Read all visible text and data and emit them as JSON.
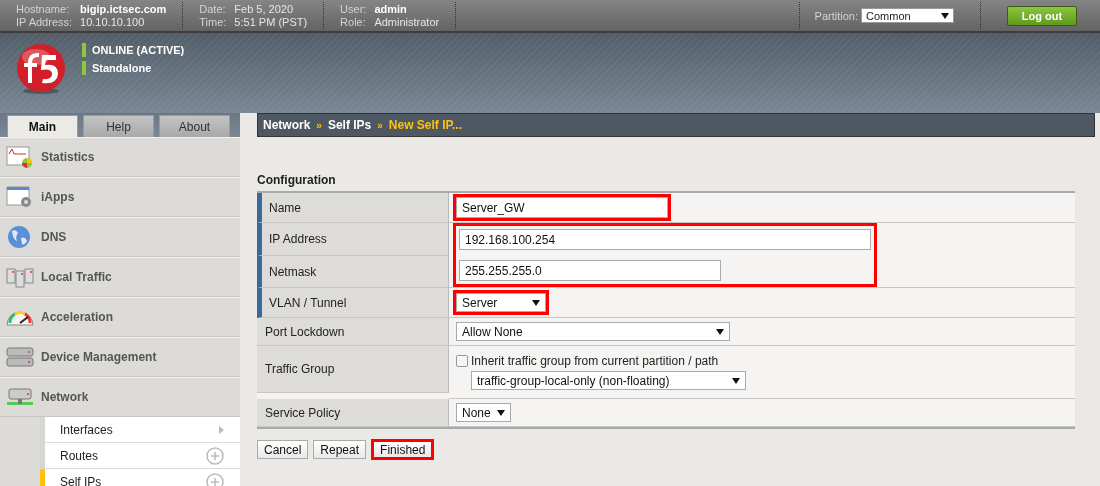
{
  "header": {
    "info": [
      [
        {
          "label": "Hostname:",
          "value": "bigip.ictsec.com",
          "strong": true
        },
        {
          "label": "IP Address:",
          "value": "10.10.10.100",
          "strong": false
        }
      ],
      [
        {
          "label": "Date:",
          "value": "Feb 5, 2020",
          "strong": false
        },
        {
          "label": "Time:",
          "value": "5:51 PM (PST)",
          "strong": false
        }
      ],
      [
        {
          "label": "User:",
          "value": "admin",
          "strong": true
        },
        {
          "label": "Role:",
          "value": "Administrator",
          "strong": false
        }
      ]
    ],
    "partition": {
      "label": "Partition:",
      "value": "Common"
    },
    "logout": "Log out"
  },
  "status": [
    {
      "text": "ONLINE (ACTIVE)",
      "color": "#8dc63f"
    },
    {
      "text": "Standalone",
      "color": "#8dc63f"
    }
  ],
  "tabs": [
    {
      "label": "Main",
      "selected": true
    },
    {
      "label": "Help",
      "selected": false
    },
    {
      "label": "About",
      "selected": false
    }
  ],
  "sidebar": {
    "items": [
      {
        "label": "Statistics"
      },
      {
        "label": "iApps"
      },
      {
        "label": "DNS"
      },
      {
        "label": "Local Traffic"
      },
      {
        "label": "Acceleration"
      },
      {
        "label": "Device Management"
      },
      {
        "label": "Network",
        "children": [
          {
            "label": "Interfaces",
            "selected": false
          },
          {
            "label": "Routes",
            "selected": false
          },
          {
            "label": "Self IPs",
            "selected": true
          }
        ]
      }
    ]
  },
  "breadcrumb": [
    {
      "label": "Network",
      "current": false
    },
    {
      "separator": "»",
      "label": "Self IPs",
      "current": false
    },
    {
      "separator": "»",
      "label": "New Self IP...",
      "current": true
    }
  ],
  "section_title": "Configuration",
  "rows": [
    {
      "kind": "row",
      "label": "Name",
      "required": true,
      "highlighted": true,
      "field": {
        "kind": "text",
        "value": "Server_GW"
      }
    },
    {
      "kind": "group",
      "highlighted": true,
      "rows": [
        {
          "label": "IP Address",
          "required": true,
          "field": {
            "kind": "text",
            "value": "192.168.100.254"
          }
        },
        {
          "label": "Netmask",
          "required": true,
          "field": {
            "kind": "text",
            "value": "255.255.255.0"
          }
        }
      ]
    },
    {
      "kind": "row",
      "label": "VLAN / Tunnel",
      "required": true,
      "highlighted": true,
      "field": {
        "kind": "select",
        "value": "Server"
      }
    },
    {
      "kind": "row",
      "label": "Port Lockdown",
      "required": false,
      "highlighted": false,
      "field": {
        "kind": "select",
        "value": "Allow None"
      }
    },
    {
      "kind": "row",
      "label": "Traffic Group",
      "required": false,
      "highlighted": false,
      "field": {
        "kind": "checkselect",
        "checkbox": {
          "label": "Inherit traffic group from current partition / path",
          "checked": false
        },
        "value": "traffic-group-local-only (non-floating)"
      }
    },
    {
      "kind": "row",
      "label": "Service Policy",
      "required": false,
      "highlighted": false,
      "field": {
        "kind": "select",
        "value": "None"
      }
    }
  ],
  "buttons": [
    {
      "label": "Cancel",
      "highlighted": false
    },
    {
      "label": "Repeat",
      "highlighted": false
    },
    {
      "label": "Finished",
      "highlighted": true
    }
  ]
}
